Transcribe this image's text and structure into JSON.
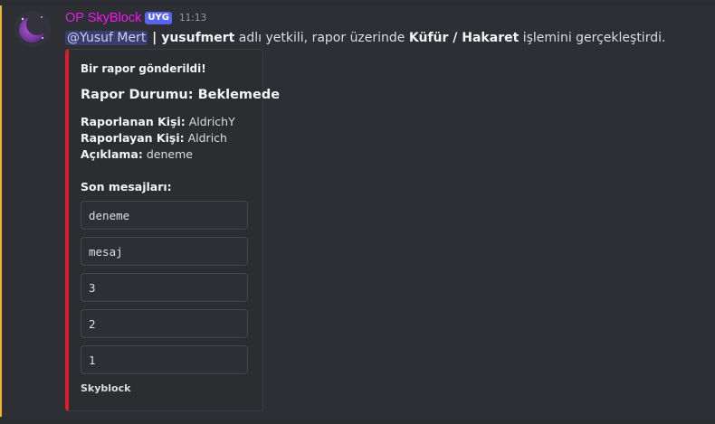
{
  "message": {
    "username": "OP SkyBlock",
    "role_tag": "UYG",
    "timestamp": "11:13",
    "mention": "@Yusuf Mert",
    "separator": " | ",
    "moderator": "yusufmert",
    "text_before_action": " adlı yetkili, rapor üzerinde ",
    "action": "Küfür / Hakaret",
    "text_after_action": " işlemini gerçekleştirdi."
  },
  "embed": {
    "author": "Bir rapor gönderildi!",
    "title": "Rapor Durumu: Beklemede",
    "fields": [
      {
        "key": "Raporlanan Kişi:",
        "value": " AldrichY"
      },
      {
        "key": "Raporlayan Kişi:",
        "value": " Aldrich"
      },
      {
        "key": "Açıklama:",
        "value": " deneme"
      }
    ],
    "recent_label": "Son mesajları:",
    "recent_messages": [
      "deneme",
      "mesaj",
      "3",
      "2",
      "1"
    ],
    "footer": "Skyblock",
    "accent_color": "#da1e28"
  },
  "colors": {
    "username": "#e91ee9",
    "role_tag_bg": "#5865f2",
    "highlight_bar": "#f0b232"
  }
}
